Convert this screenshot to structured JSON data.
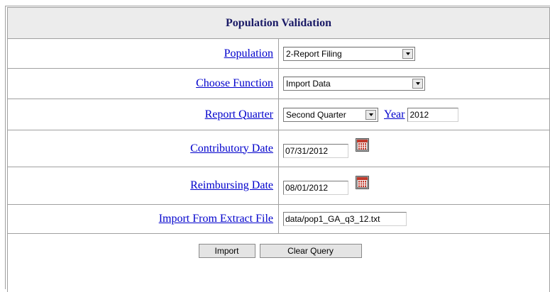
{
  "form": {
    "title": "Population Validation",
    "rows": {
      "population": {
        "label": "Population",
        "value": "2-Report Filing"
      },
      "choose_function": {
        "label": "Choose Function",
        "value": "Import Data"
      },
      "report_quarter": {
        "label": "Report Quarter",
        "value": "Second Quarter",
        "year_label": "Year",
        "year_value": "2012"
      },
      "contributory_date": {
        "label": "Contributory Date",
        "value": "07/31/2012"
      },
      "reimbursing_date": {
        "label": "Reimbursing Date",
        "value": "08/01/2012"
      },
      "import_file": {
        "label": "Import From Extract File",
        "value": "data/pop1_GA_q3_12.txt"
      }
    },
    "buttons": {
      "import": "Import",
      "clear": "Clear Query"
    }
  },
  "icons": {
    "calendar": "calendar-icon",
    "dropdown": "chevron-down-icon"
  }
}
